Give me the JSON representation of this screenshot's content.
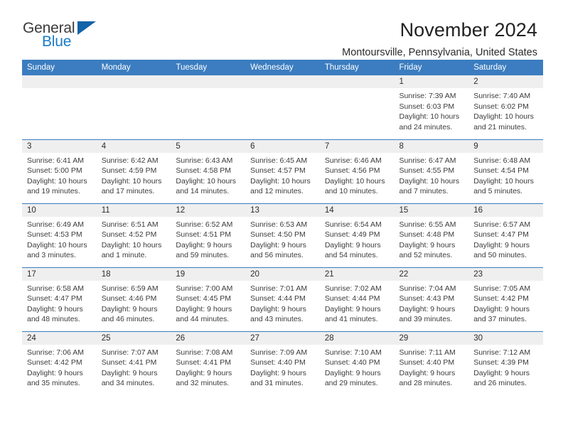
{
  "brand": {
    "name_part1": "General",
    "name_part2": "Blue",
    "triangle_icon": "triangle-icon",
    "accent_color": "#1a7bc6"
  },
  "header": {
    "month_title": "November 2024",
    "location": "Montoursville, Pennsylvania, United States"
  },
  "colors": {
    "header_blue": "#3b7dc0",
    "daynum_gray": "#efefef",
    "text_dark": "#2d2d2d"
  },
  "calendar": {
    "weekday_headers": [
      "Sunday",
      "Monday",
      "Tuesday",
      "Wednesday",
      "Thursday",
      "Friday",
      "Saturday"
    ],
    "labels": {
      "sunrise": "Sunrise:",
      "sunset": "Sunset:",
      "daylight": "Daylight:"
    },
    "weeks": [
      [
        {
          "day": "",
          "empty": true
        },
        {
          "day": "",
          "empty": true
        },
        {
          "day": "",
          "empty": true
        },
        {
          "day": "",
          "empty": true
        },
        {
          "day": "",
          "empty": true
        },
        {
          "day": "1",
          "sunrise": "Sunrise: 7:39 AM",
          "sunset": "Sunset: 6:03 PM",
          "daylight_l1": "Daylight: 10 hours",
          "daylight_l2": "and 24 minutes."
        },
        {
          "day": "2",
          "sunrise": "Sunrise: 7:40 AM",
          "sunset": "Sunset: 6:02 PM",
          "daylight_l1": "Daylight: 10 hours",
          "daylight_l2": "and 21 minutes."
        }
      ],
      [
        {
          "day": "3",
          "sunrise": "Sunrise: 6:41 AM",
          "sunset": "Sunset: 5:00 PM",
          "daylight_l1": "Daylight: 10 hours",
          "daylight_l2": "and 19 minutes."
        },
        {
          "day": "4",
          "sunrise": "Sunrise: 6:42 AM",
          "sunset": "Sunset: 4:59 PM",
          "daylight_l1": "Daylight: 10 hours",
          "daylight_l2": "and 17 minutes."
        },
        {
          "day": "5",
          "sunrise": "Sunrise: 6:43 AM",
          "sunset": "Sunset: 4:58 PM",
          "daylight_l1": "Daylight: 10 hours",
          "daylight_l2": "and 14 minutes."
        },
        {
          "day": "6",
          "sunrise": "Sunrise: 6:45 AM",
          "sunset": "Sunset: 4:57 PM",
          "daylight_l1": "Daylight: 10 hours",
          "daylight_l2": "and 12 minutes."
        },
        {
          "day": "7",
          "sunrise": "Sunrise: 6:46 AM",
          "sunset": "Sunset: 4:56 PM",
          "daylight_l1": "Daylight: 10 hours",
          "daylight_l2": "and 10 minutes."
        },
        {
          "day": "8",
          "sunrise": "Sunrise: 6:47 AM",
          "sunset": "Sunset: 4:55 PM",
          "daylight_l1": "Daylight: 10 hours",
          "daylight_l2": "and 7 minutes."
        },
        {
          "day": "9",
          "sunrise": "Sunrise: 6:48 AM",
          "sunset": "Sunset: 4:54 PM",
          "daylight_l1": "Daylight: 10 hours",
          "daylight_l2": "and 5 minutes."
        }
      ],
      [
        {
          "day": "10",
          "sunrise": "Sunrise: 6:49 AM",
          "sunset": "Sunset: 4:53 PM",
          "daylight_l1": "Daylight: 10 hours",
          "daylight_l2": "and 3 minutes."
        },
        {
          "day": "11",
          "sunrise": "Sunrise: 6:51 AM",
          "sunset": "Sunset: 4:52 PM",
          "daylight_l1": "Daylight: 10 hours",
          "daylight_l2": "and 1 minute."
        },
        {
          "day": "12",
          "sunrise": "Sunrise: 6:52 AM",
          "sunset": "Sunset: 4:51 PM",
          "daylight_l1": "Daylight: 9 hours",
          "daylight_l2": "and 59 minutes."
        },
        {
          "day": "13",
          "sunrise": "Sunrise: 6:53 AM",
          "sunset": "Sunset: 4:50 PM",
          "daylight_l1": "Daylight: 9 hours",
          "daylight_l2": "and 56 minutes."
        },
        {
          "day": "14",
          "sunrise": "Sunrise: 6:54 AM",
          "sunset": "Sunset: 4:49 PM",
          "daylight_l1": "Daylight: 9 hours",
          "daylight_l2": "and 54 minutes."
        },
        {
          "day": "15",
          "sunrise": "Sunrise: 6:55 AM",
          "sunset": "Sunset: 4:48 PM",
          "daylight_l1": "Daylight: 9 hours",
          "daylight_l2": "and 52 minutes."
        },
        {
          "day": "16",
          "sunrise": "Sunrise: 6:57 AM",
          "sunset": "Sunset: 4:47 PM",
          "daylight_l1": "Daylight: 9 hours",
          "daylight_l2": "and 50 minutes."
        }
      ],
      [
        {
          "day": "17",
          "sunrise": "Sunrise: 6:58 AM",
          "sunset": "Sunset: 4:47 PM",
          "daylight_l1": "Daylight: 9 hours",
          "daylight_l2": "and 48 minutes."
        },
        {
          "day": "18",
          "sunrise": "Sunrise: 6:59 AM",
          "sunset": "Sunset: 4:46 PM",
          "daylight_l1": "Daylight: 9 hours",
          "daylight_l2": "and 46 minutes."
        },
        {
          "day": "19",
          "sunrise": "Sunrise: 7:00 AM",
          "sunset": "Sunset: 4:45 PM",
          "daylight_l1": "Daylight: 9 hours",
          "daylight_l2": "and 44 minutes."
        },
        {
          "day": "20",
          "sunrise": "Sunrise: 7:01 AM",
          "sunset": "Sunset: 4:44 PM",
          "daylight_l1": "Daylight: 9 hours",
          "daylight_l2": "and 43 minutes."
        },
        {
          "day": "21",
          "sunrise": "Sunrise: 7:02 AM",
          "sunset": "Sunset: 4:44 PM",
          "daylight_l1": "Daylight: 9 hours",
          "daylight_l2": "and 41 minutes."
        },
        {
          "day": "22",
          "sunrise": "Sunrise: 7:04 AM",
          "sunset": "Sunset: 4:43 PM",
          "daylight_l1": "Daylight: 9 hours",
          "daylight_l2": "and 39 minutes."
        },
        {
          "day": "23",
          "sunrise": "Sunrise: 7:05 AM",
          "sunset": "Sunset: 4:42 PM",
          "daylight_l1": "Daylight: 9 hours",
          "daylight_l2": "and 37 minutes."
        }
      ],
      [
        {
          "day": "24",
          "sunrise": "Sunrise: 7:06 AM",
          "sunset": "Sunset: 4:42 PM",
          "daylight_l1": "Daylight: 9 hours",
          "daylight_l2": "and 35 minutes."
        },
        {
          "day": "25",
          "sunrise": "Sunrise: 7:07 AM",
          "sunset": "Sunset: 4:41 PM",
          "daylight_l1": "Daylight: 9 hours",
          "daylight_l2": "and 34 minutes."
        },
        {
          "day": "26",
          "sunrise": "Sunrise: 7:08 AM",
          "sunset": "Sunset: 4:41 PM",
          "daylight_l1": "Daylight: 9 hours",
          "daylight_l2": "and 32 minutes."
        },
        {
          "day": "27",
          "sunrise": "Sunrise: 7:09 AM",
          "sunset": "Sunset: 4:40 PM",
          "daylight_l1": "Daylight: 9 hours",
          "daylight_l2": "and 31 minutes."
        },
        {
          "day": "28",
          "sunrise": "Sunrise: 7:10 AM",
          "sunset": "Sunset: 4:40 PM",
          "daylight_l1": "Daylight: 9 hours",
          "daylight_l2": "and 29 minutes."
        },
        {
          "day": "29",
          "sunrise": "Sunrise: 7:11 AM",
          "sunset": "Sunset: 4:40 PM",
          "daylight_l1": "Daylight: 9 hours",
          "daylight_l2": "and 28 minutes."
        },
        {
          "day": "30",
          "sunrise": "Sunrise: 7:12 AM",
          "sunset": "Sunset: 4:39 PM",
          "daylight_l1": "Daylight: 9 hours",
          "daylight_l2": "and 26 minutes."
        }
      ]
    ]
  }
}
